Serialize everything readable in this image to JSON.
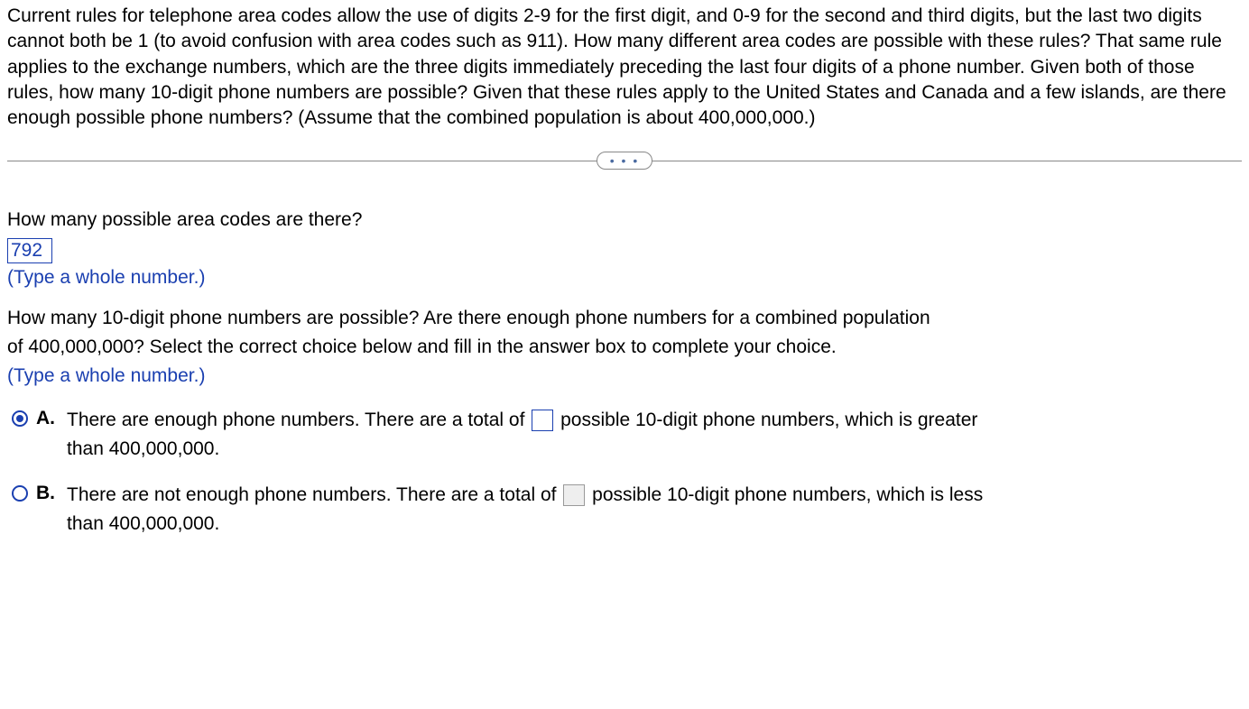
{
  "problem": {
    "text": "Current rules for telephone area codes allow the use of digits 2-9 for the first digit, and 0-9 for the second and third digits, but the last two digits cannot both be 1 (to avoid confusion with area codes such as 911). How many different area codes are possible with these rules? That same rule applies to the exchange numbers, which are the three digits immediately preceding the last four digits of a phone number. Given both of those rules, how many 10-digit phone numbers are possible? Given that these rules apply to the United States and Canada and a few islands, are there enough possible phone numbers? (Assume that the combined population is about 400,000,000.)"
  },
  "divider": {
    "dots": "• • •"
  },
  "q1": {
    "prompt": "How many possible area codes are there?",
    "value": "792",
    "hint": "(Type a whole number.)"
  },
  "q2": {
    "line1": "How many 10-digit phone numbers are possible? Are there enough phone numbers for a combined population",
    "line2": "of 400,000,000? Select the correct choice below and fill in the answer box to complete your choice.",
    "hint": "(Type a whole number.)"
  },
  "choices": {
    "a": {
      "letter": "A.",
      "pre": "There are enough phone numbers. There are a total of ",
      "post1": " possible 10-digit phone numbers, which is greater",
      "post2": "than 400,000,000.",
      "value": ""
    },
    "b": {
      "letter": "B.",
      "pre": "There are not enough phone numbers. There are a total of ",
      "post1": " possible 10-digit phone numbers, which is less",
      "post2": "than 400,000,000.",
      "value": ""
    }
  }
}
